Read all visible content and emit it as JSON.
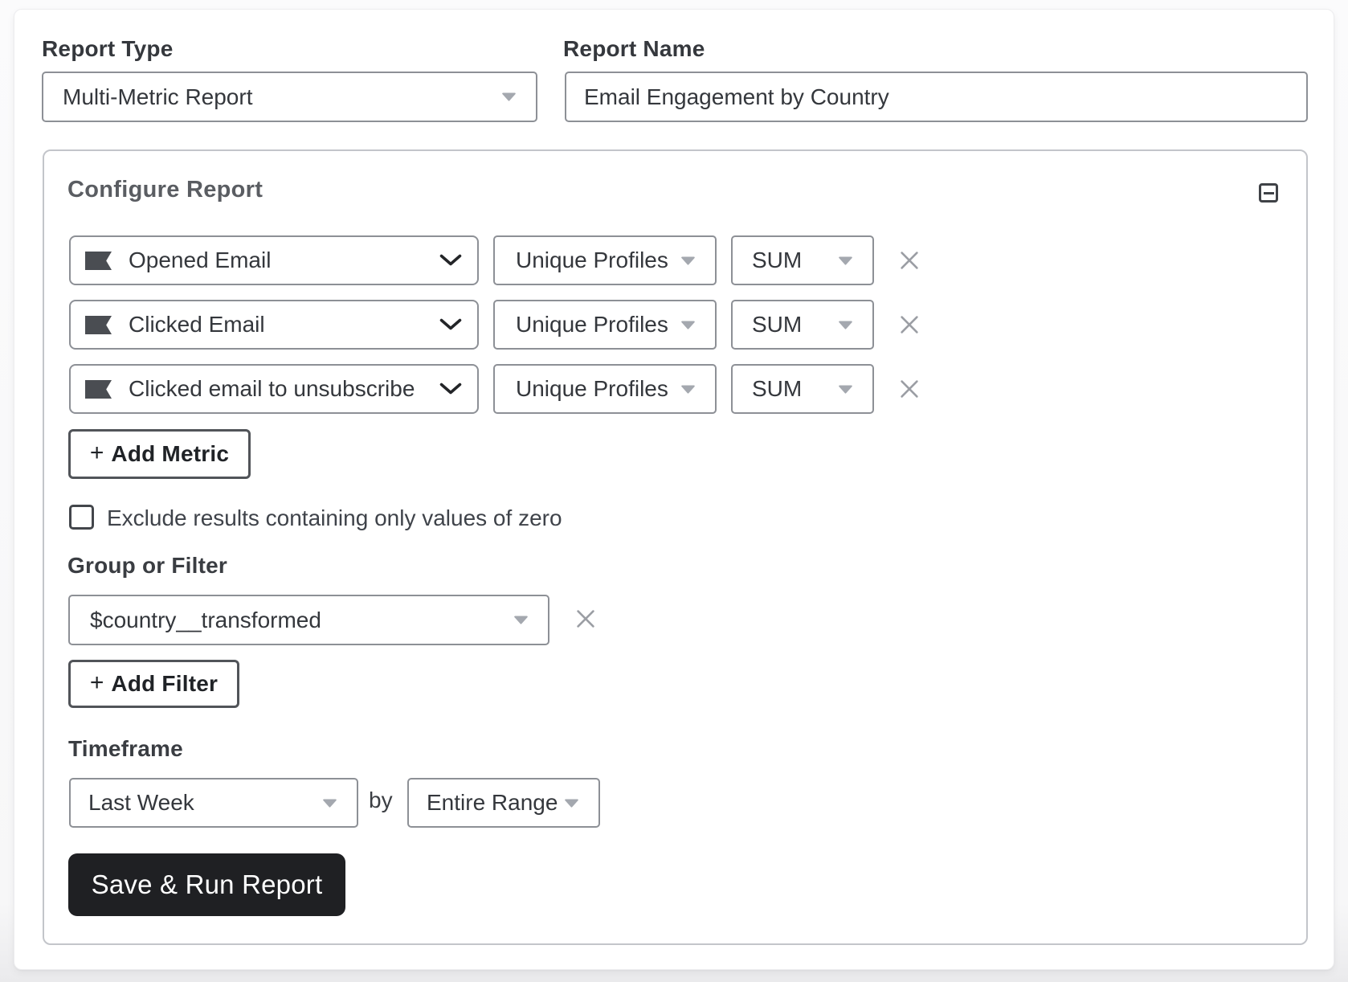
{
  "header": {
    "report_type": {
      "label": "Report Type",
      "value": "Multi-Metric Report"
    },
    "report_name": {
      "label": "Report Name",
      "value": "Email Engagement by Country"
    }
  },
  "configure": {
    "title": "Configure Report",
    "collapse_icon": "minus-square",
    "metrics": [
      {
        "icon": "klaviyo-flag",
        "metric": "Opened Email",
        "measurement": "Unique Profiles",
        "aggregation": "SUM",
        "remove_icon": "x"
      },
      {
        "icon": "klaviyo-flag",
        "metric": "Clicked Email",
        "measurement": "Unique Profiles",
        "aggregation": "SUM",
        "remove_icon": "x"
      },
      {
        "icon": "klaviyo-flag",
        "metric": "Clicked email to unsubscribe",
        "measurement": "Unique Profiles",
        "aggregation": "SUM",
        "remove_icon": "x"
      }
    ],
    "add_metric": {
      "plus": "+",
      "label": "Add Metric"
    },
    "exclude_zero": {
      "label": "Exclude results containing only values of zero",
      "checked": false
    },
    "group_or_filter": {
      "label": "Group or Filter",
      "value": "$country__transformed",
      "remove_icon": "x"
    },
    "add_filter": {
      "plus": "+",
      "label": "Add Filter"
    },
    "timeframe": {
      "label": "Timeframe",
      "range": "Last Week",
      "by": "by",
      "interval": "Entire Range"
    },
    "save_button_label": "Save & Run Report"
  },
  "colors": {
    "page_background": "#f7f7f8",
    "card_background": "#ffffff",
    "control_border": "#8d9096",
    "panel_border": "#c3c5ca",
    "text": "#34373c",
    "heading_muted": "#5a5d62",
    "icon_gray": "#9b9ea4",
    "flag_icon": "#4a4d52",
    "save_button_background": "#1f2023",
    "save_button_text": "#ffffff"
  }
}
